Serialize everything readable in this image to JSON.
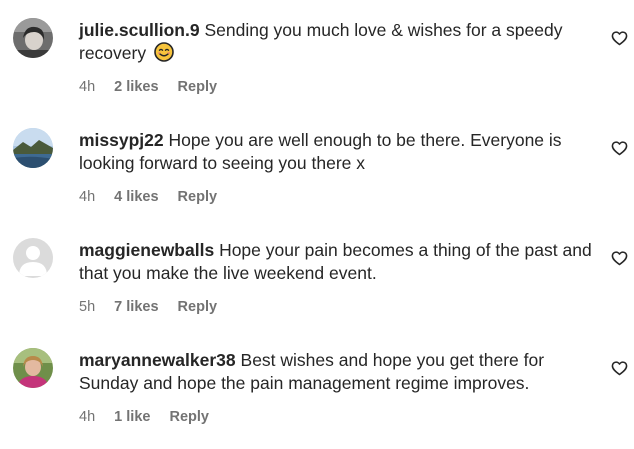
{
  "comments": [
    {
      "username": "julie.scullion.9",
      "text": "Sending you much love & wishes for a speedy recovery",
      "emoji": "smiling-face-emoji",
      "time": "4h",
      "likes": "2 likes",
      "reply": "Reply",
      "avatar": "profile-photo"
    },
    {
      "username": "missypj22",
      "text": "Hope you are well enough to be there. Everyone is looking forward to seeing you there x",
      "time": "4h",
      "likes": "4 likes",
      "reply": "Reply",
      "avatar": "landscape-photo"
    },
    {
      "username": "maggienewballs",
      "text": "Hope your pain becomes a thing of the past and that you make the live weekend event.",
      "time": "5h",
      "likes": "7 likes",
      "reply": "Reply",
      "avatar": "default-avatar"
    },
    {
      "username": "maryannewalker38",
      "text": "Best wishes and hope you get there for Sunday and hope the pain management regime improves.",
      "time": "4h",
      "likes": "1 like",
      "reply": "Reply",
      "avatar": "profile-photo"
    }
  ],
  "colors": {
    "text": "#262626",
    "meta": "#737373",
    "heart_stroke": "#262626"
  },
  "icons": {
    "like": "heart-outline-icon"
  }
}
